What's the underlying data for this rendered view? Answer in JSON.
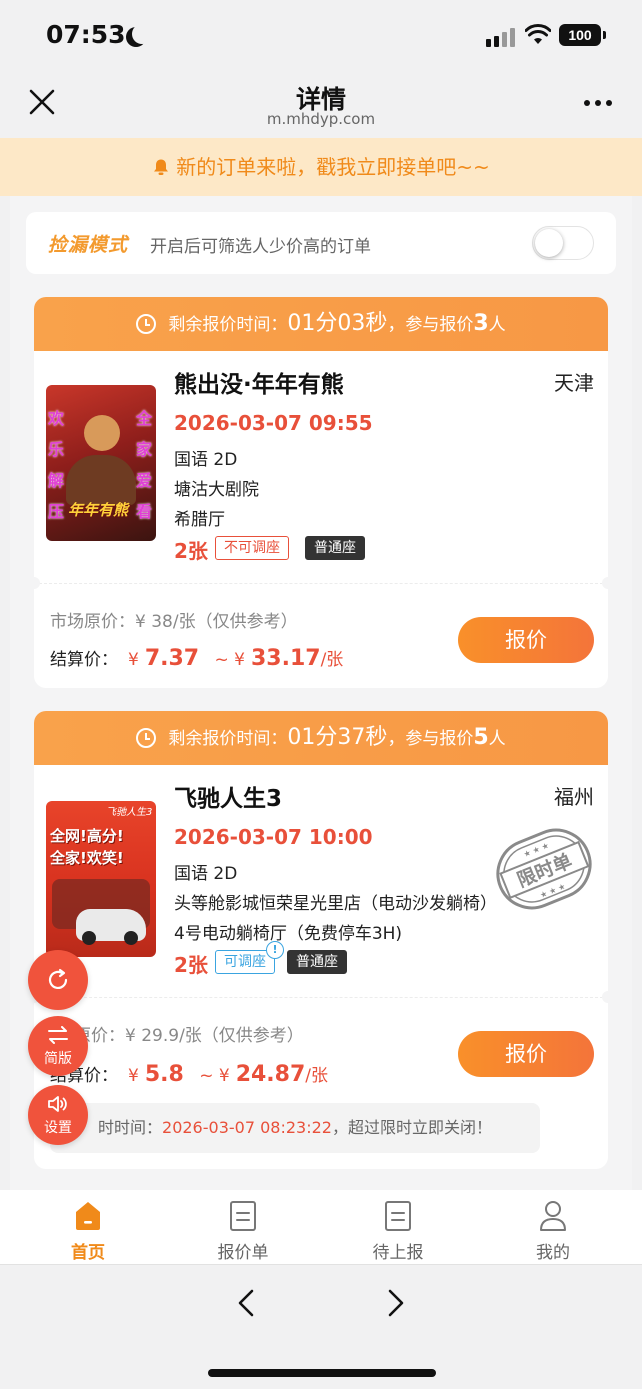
{
  "status_bar": {
    "time": "07:53",
    "battery": "100"
  },
  "nav": {
    "title": "详情",
    "domain": "m.mhdyp.com"
  },
  "notice": {
    "text": "新的订单来啦，戳我立即接单吧~~"
  },
  "mode": {
    "title": "捡漏模式",
    "desc": "开启后可筛选人少价高的订单",
    "enabled": false
  },
  "orders": [
    {
      "timer_label": "剩余报价时间：",
      "timer_value": "01分03秒",
      "participants_label": "参与报价",
      "participants_count": "3",
      "participants_unit": "人",
      "title": "熊出没·年年有熊",
      "city": "天津",
      "showtime": "2026-03-07 09:55",
      "format": "国语 2D",
      "cinema": "塘沽大剧院",
      "hall": "希腊厅",
      "quantity": "2张",
      "tag_seat_adjust": "不可调座",
      "tag_seat_type": "普通座",
      "poster_text": [
        "欢",
        "乐",
        "解",
        "压",
        "全",
        "家",
        "爱",
        "看",
        "年年有熊"
      ],
      "market_price": "市场原价：¥ 38/张（仅供参考）",
      "settle_label": "结算价：",
      "settle_min": "7.37",
      "settle_max": "33.17",
      "settle_unit": "/张",
      "quote_label": "报价"
    },
    {
      "timer_label": "剩余报价时间：",
      "timer_value": "01分37秒",
      "participants_label": "参与报价",
      "participants_count": "5",
      "participants_unit": "人",
      "title": "飞驰人生3",
      "city": "福州",
      "showtime": "2026-03-07 10:00",
      "format": "国语 2D",
      "cinema": "头等舱影城恒荣星光里店（电动沙发躺椅）",
      "hall": "4号电动躺椅厅（免费停车3H)",
      "quantity": "2张",
      "tag_seat_adjust": "可调座",
      "tag_seat_type": "普通座",
      "poster_text": [
        "飞驰人生3",
        "全网!高分!",
        "全家!欢笑!"
      ],
      "stamp_text": "限时单",
      "market_price": "原价：¥ 29.9/张（仅供参考）",
      "settle_label": "结算价：",
      "settle_min": "5.8",
      "settle_max": "24.87",
      "settle_unit": "/张",
      "quote_label": "报价",
      "deadline_label": "时时间：",
      "deadline_value": "2026-03-07 08:23:22",
      "deadline_suffix": "，超过限时立即关闭！"
    }
  ],
  "fab": {
    "mode_label": "简版",
    "settings_label": "设置"
  },
  "tabs": [
    {
      "label": "首页",
      "active": true
    },
    {
      "label": "报价单",
      "active": false
    },
    {
      "label": "待上报",
      "active": false
    },
    {
      "label": "我的",
      "active": false
    }
  ],
  "colors": {
    "accent": "#f08a1a",
    "price_red": "#e8503a",
    "fab_red": "#f0533c",
    "header_orange": "#f9a24b"
  }
}
